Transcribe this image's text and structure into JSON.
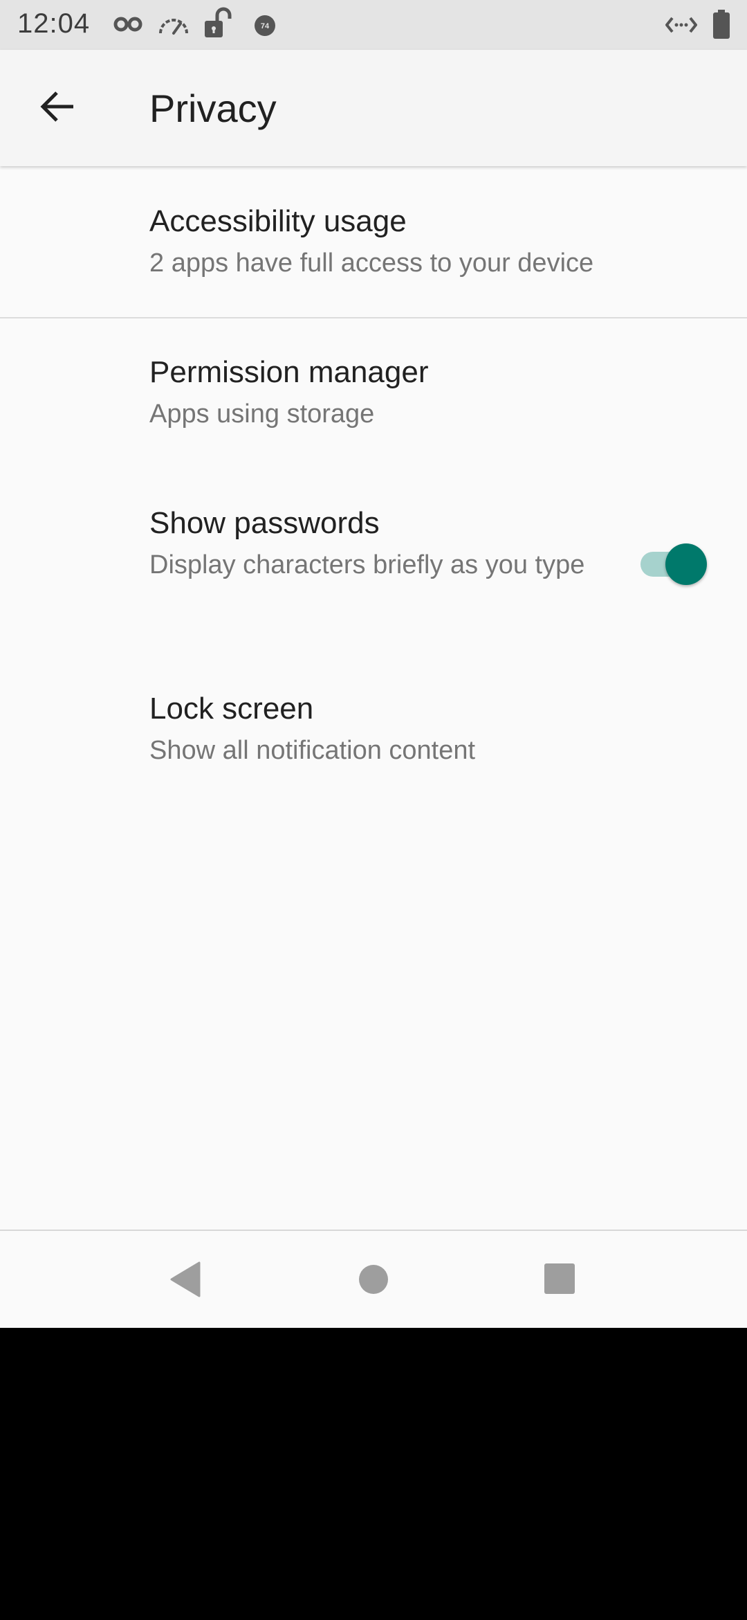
{
  "status_bar": {
    "time": "12:04",
    "icons": [
      "incognito-icon",
      "speedometer-icon",
      "unlock-icon",
      "badge-74-icon",
      "data-transfer-icon",
      "battery-icon"
    ],
    "badge_text": "74"
  },
  "app_bar": {
    "back_icon": "arrow-back-icon",
    "title": "Privacy"
  },
  "items": [
    {
      "title": "Accessibility usage",
      "summary": "2 apps have full access to your device"
    },
    {
      "title": "Permission manager",
      "summary": "Apps using storage"
    },
    {
      "title": "Show passwords",
      "summary": "Display characters briefly as you type",
      "toggle_on": true
    },
    {
      "title": "Lock screen",
      "summary": "Show all notification content"
    }
  ],
  "nav_bar": {
    "buttons": [
      "back-triangle-icon",
      "home-circle-icon",
      "recents-square-icon"
    ]
  },
  "colors": {
    "accent": "#00796b",
    "accent_track": "#a6d2cd",
    "status_bar_bg": "#e4e4e4",
    "background": "#fafafa"
  }
}
